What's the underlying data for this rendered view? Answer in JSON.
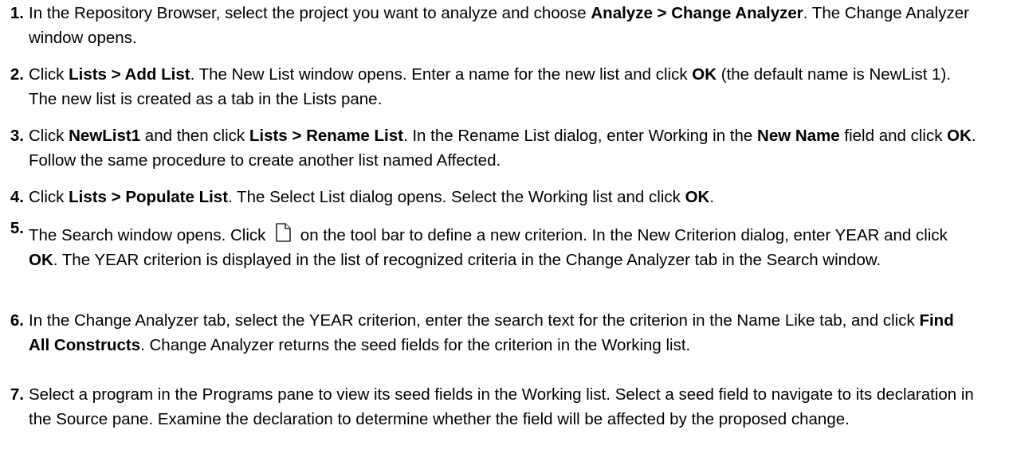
{
  "steps": [
    {
      "number": "1.",
      "parts": [
        "In the Repository Browser, select the project you want to analyze and choose ",
        "Analyze > Change Analyzer",
        ". The Change Analyzer window opens."
      ]
    },
    {
      "number": "2.",
      "parts": [
        "Click ",
        "Lists > Add List",
        ". The New List window opens. Enter a name for the new list and click ",
        "OK",
        " (the default name is NewList 1). The new list is created as a tab in the Lists pane."
      ]
    },
    {
      "number": "3.",
      "parts": [
        "Click ",
        "NewList1",
        " and then click ",
        "Lists > Rename List",
        ". In the Rename List dialog, enter Working in the ",
        "New Name",
        " field and click ",
        "OK",
        ". Follow the same procedure to create another list named Affected."
      ]
    },
    {
      "number": "4.",
      "parts": [
        "Click ",
        "Lists > Populate List",
        ". The Select List dialog opens. Select the Working list and click ",
        "OK",
        "."
      ]
    },
    {
      "number": "5.",
      "parts": [
        "The Search window opens. Click ",
        " on the tool bar to define a new criterion. In the New Criterion dialog, enter YEAR and click ",
        "OK",
        ". The YEAR criterion is displayed in the list of recognized criteria in the Change Analyzer tab in the Search window."
      ],
      "icon": "new-document-icon"
    },
    {
      "number": "6.",
      "parts": [
        "In the Change Analyzer tab, select the YEAR criterion, enter the search text for the criterion in the Name Like tab, and click ",
        "Find All Constructs",
        ". Change Analyzer returns the seed fields for the criterion in the Working list."
      ]
    },
    {
      "number": "7.",
      "parts": [
        "Select a program in the Programs pane to view its seed fields in the Working list. Select a seed field to navigate to its declaration in the Source pane. Examine the declaration to determine whether the field will be affected by the proposed change."
      ]
    }
  ]
}
